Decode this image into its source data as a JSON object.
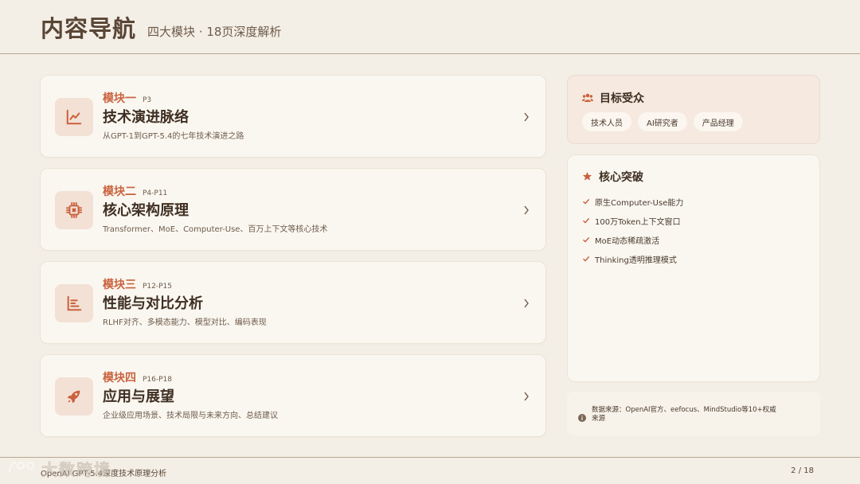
{
  "header": {
    "title": "内容导航",
    "subtitle": "四大模块 · 18页深度解析"
  },
  "modules": [
    {
      "label": "模块一",
      "pages": "P3",
      "title": "技术演进脉络",
      "desc": "从GPT-1到GPT-5.4的七年技术演进之路",
      "icon": "line-chart-icon"
    },
    {
      "label": "模块二",
      "pages": "P4-P11",
      "title": "核心架构原理",
      "desc": "Transformer、MoE、Computer-Use、百万上下文等核心技术",
      "icon": "chip-icon"
    },
    {
      "label": "模块三",
      "pages": "P12-P15",
      "title": "性能与对比分析",
      "desc": "RLHF对齐、多模态能力、模型对比、编码表现",
      "icon": "bar-chart-icon"
    },
    {
      "label": "模块四",
      "pages": "P16-P18",
      "title": "应用与展望",
      "desc": "企业级应用场景、技术局限与未来方向、总结建议",
      "icon": "rocket-icon"
    }
  ],
  "audience": {
    "title": "目标受众",
    "tags": [
      "技术人员",
      "AI研究者",
      "产品经理"
    ]
  },
  "core": {
    "title": "核心突破",
    "items": [
      "原生Computer-Use能力",
      "100万Token上下文窗口",
      "MoE动态稀疏激活",
      "Thinking透明推理模式"
    ]
  },
  "source": {
    "text": "数据来源：OpenAI官方、eefocus、MindStudio等10+权威来源"
  },
  "footer": {
    "left": "OpenAI GPT-5.4深度技术原理分析",
    "right": "2 / 18"
  },
  "watermark": {
    "text": "大数跨境"
  },
  "colors": {
    "accent": "#c9623c",
    "background": "#f4efe6",
    "icon_bg": "#f3e1d6"
  }
}
